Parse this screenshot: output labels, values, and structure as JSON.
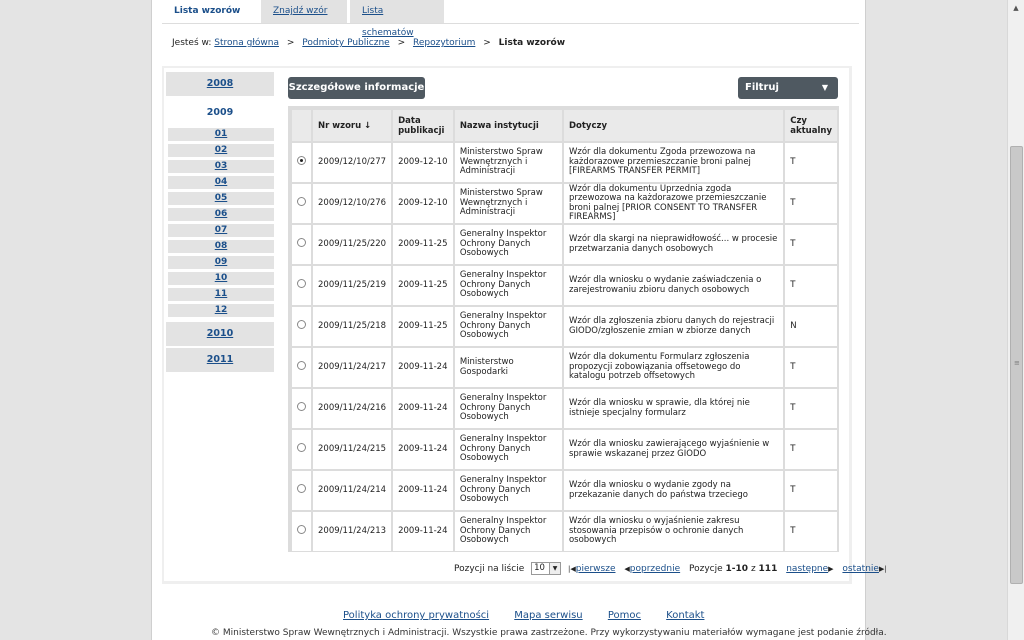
{
  "tabs": [
    {
      "label": "Lista wzorów",
      "active": true
    },
    {
      "label": "Znajdź wzór",
      "active": false
    },
    {
      "label": "Lista schematów",
      "active": false
    }
  ],
  "breadcrumb": {
    "prefix": "Jesteś w:",
    "items": [
      "Strona główna",
      "Podmioty Publiczne",
      "Repozytorium"
    ],
    "separator": ">",
    "current": "Lista wzorów"
  },
  "sidebar": {
    "years_before": [
      "2008"
    ],
    "selected_year": "2009",
    "months": [
      "01",
      "02",
      "03",
      "04",
      "05",
      "06",
      "07",
      "08",
      "09",
      "10",
      "11",
      "12"
    ],
    "years_after": [
      "2010",
      "2011"
    ]
  },
  "buttons": {
    "details": "Szczegółowe informacje",
    "filter": "Filtruj"
  },
  "table": {
    "headers": {
      "nr": "Nr wzoru",
      "date": "Data publikacji",
      "institution": "Nazwa instytucji",
      "concerns": "Dotyczy",
      "current": "Czy aktualny"
    },
    "rows": [
      {
        "selected": true,
        "nr": "2009/12/10/277",
        "date": "2009-12-10",
        "institution": "Ministerstwo Spraw Wewnętrznych i Administracji",
        "concerns": "Wzór dla dokumentu Zgoda przewozowa na każdorazowe przemieszczanie broni palnej [FIREARMS TRANSFER PERMIT]",
        "current": "T"
      },
      {
        "selected": false,
        "nr": "2009/12/10/276",
        "date": "2009-12-10",
        "institution": "Ministerstwo Spraw Wewnętrznych i Administracji",
        "concerns": "Wzór dla dokumentu Uprzednia zgoda przewozowa na każdorazowe przemieszczanie broni palnej [PRIOR CONSENT TO TRANSFER FIREARMS]",
        "current": "T"
      },
      {
        "selected": false,
        "nr": "2009/11/25/220",
        "date": "2009-11-25",
        "institution": "Generalny Inspektor Ochrony Danych Osobowych",
        "concerns": "Wzór dla skargi na nieprawidłowość... w procesie przetwarzania danych osobowych",
        "current": "T"
      },
      {
        "selected": false,
        "nr": "2009/11/25/219",
        "date": "2009-11-25",
        "institution": "Generalny Inspektor Ochrony Danych Osobowych",
        "concerns": "Wzór dla wniosku o wydanie zaświadczenia o zarejestrowaniu zbioru danych osobowych",
        "current": "T"
      },
      {
        "selected": false,
        "nr": "2009/11/25/218",
        "date": "2009-11-25",
        "institution": "Generalny Inspektor Ochrony Danych Osobowych",
        "concerns": "Wzór dla zgłoszenia zbioru danych do rejestracji GIODO/zgłoszenie zmian w zbiorze danych",
        "current": "N"
      },
      {
        "selected": false,
        "nr": "2009/11/24/217",
        "date": "2009-11-24",
        "institution": "Ministerstwo Gospodarki",
        "concerns": "Wzór dla dokumentu Formularz zgłoszenia propozycji zobowiązania offsetowego do katalogu potrzeb offsetowych",
        "current": "T"
      },
      {
        "selected": false,
        "nr": "2009/11/24/216",
        "date": "2009-11-24",
        "institution": "Generalny Inspektor Ochrony Danych Osobowych",
        "concerns": "Wzór dla wniosku w sprawie, dla której nie istnieje specjalny formularz",
        "current": "T"
      },
      {
        "selected": false,
        "nr": "2009/11/24/215",
        "date": "2009-11-24",
        "institution": "Generalny Inspektor Ochrony Danych Osobowych",
        "concerns": "Wzór dla wniosku zawierającego wyjaśnienie w sprawie wskazanej przez GIODO",
        "current": "T"
      },
      {
        "selected": false,
        "nr": "2009/11/24/214",
        "date": "2009-11-24",
        "institution": "Generalny Inspektor Ochrony Danych Osobowych",
        "concerns": "Wzór dla wniosku o wydanie zgody na przekazanie danych do państwa trzeciego",
        "current": "T"
      },
      {
        "selected": false,
        "nr": "2009/11/24/213",
        "date": "2009-11-24",
        "institution": "Generalny Inspektor Ochrony Danych Osobowych",
        "concerns": "Wzór dla wniosku o wyjaśnienie zakresu stosowania przepisów o ochronie danych osobowych",
        "current": "T"
      }
    ]
  },
  "pager": {
    "per_page_label": "Pozycji na liście",
    "per_page_value": "10",
    "first": "pierwsze",
    "prev": "poprzednie",
    "positions_label": "Pozycje",
    "range": "1-10",
    "of": "z",
    "total": "111",
    "next": "następne",
    "last": "ostatnie"
  },
  "footer": {
    "links": [
      "Polityka ochrony prywatności",
      "Mapa serwisu",
      "Pomoc",
      "Kontakt"
    ],
    "copyright": "© Ministerstwo Spraw Wewnętrznych i Administracji. Wszystkie prawa zastrzeżone. Przy wykorzystywaniu materiałów wymagane jest podanie źródła."
  },
  "colors": {
    "link": "#1b4f8a",
    "button_bg": "#4f5961",
    "tab_bg": "#e2e2e2",
    "page_bg": "#e4e4e4"
  }
}
